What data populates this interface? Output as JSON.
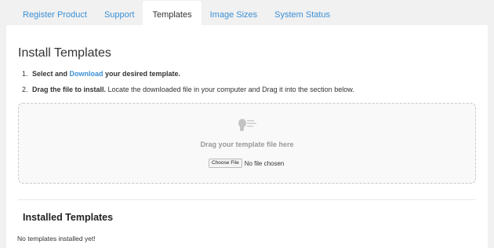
{
  "tabs": [
    {
      "label": "Register Product",
      "active": false
    },
    {
      "label": "Support",
      "active": false
    },
    {
      "label": "Templates",
      "active": true
    },
    {
      "label": "Image Sizes",
      "active": false
    },
    {
      "label": "System Status",
      "active": false
    }
  ],
  "main": {
    "title": "Install Templates",
    "steps": [
      {
        "num": "1.",
        "bold_a": "Select and ",
        "link": "Download",
        "bold_b": " your desired template.",
        "rest": ""
      },
      {
        "num": "2.",
        "bold_a": "Drag the file to install.",
        "link": "",
        "bold_b": "",
        "rest": " Locate the downloaded file in your computer and Drag it into the section below."
      }
    ],
    "dropzone": {
      "icon": "upload-hand-icon",
      "label": "Drag your template file here",
      "choose_button": "Choose File",
      "file_status": "No file chosen"
    },
    "installed": {
      "title": "Installed Templates",
      "empty_text": "No templates installed yet!"
    }
  },
  "colors": {
    "link": "#3a8fd6",
    "page_bg": "#f1f1f1",
    "panel_bg": "#ffffff",
    "dropzone_border": "#c9c9c9"
  }
}
